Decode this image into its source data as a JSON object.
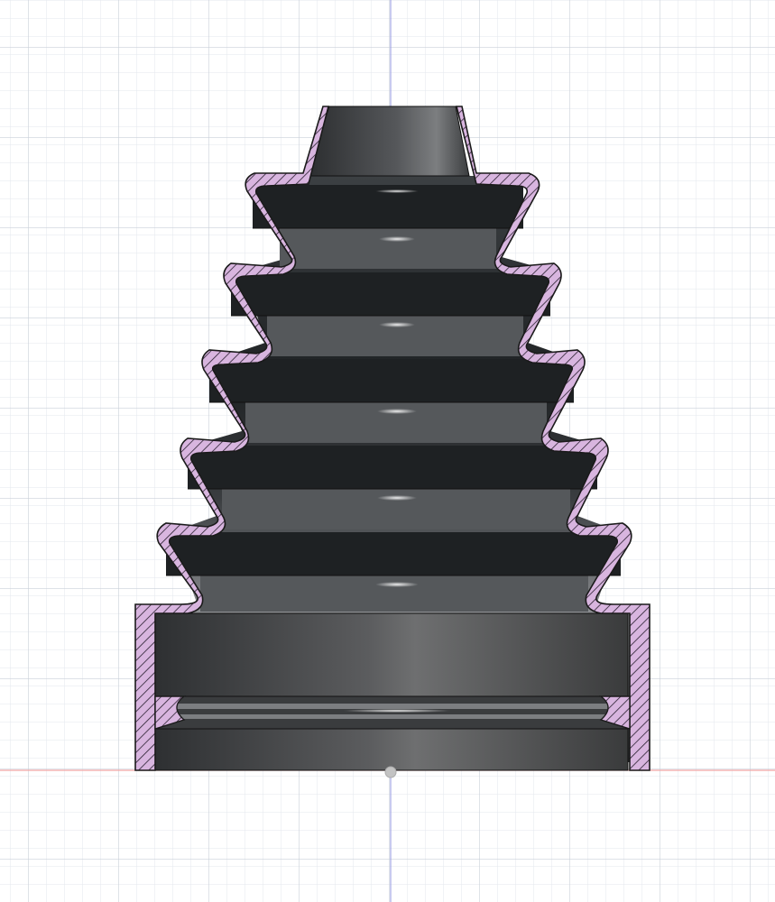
{
  "viewport": {
    "name": "cad-section-view",
    "background": "#ffffff",
    "grid_minor_color": "#e2e6ec",
    "grid_major_color": "#c7ced8"
  },
  "axes": {
    "vertical_axis_color": "#9c9fe0",
    "horizontal_axis_color": "#ef9d9d"
  },
  "model": {
    "name": "cv-joint-boot",
    "section_hatch_color": "#d5b3dc",
    "section_outline_color": "#1a1a1a",
    "body_dark": "#2b2e31",
    "body_light": "#8a8c8e"
  },
  "origin_marker": {
    "icon": "origin-point-icon",
    "color": "#b9b9b9"
  }
}
